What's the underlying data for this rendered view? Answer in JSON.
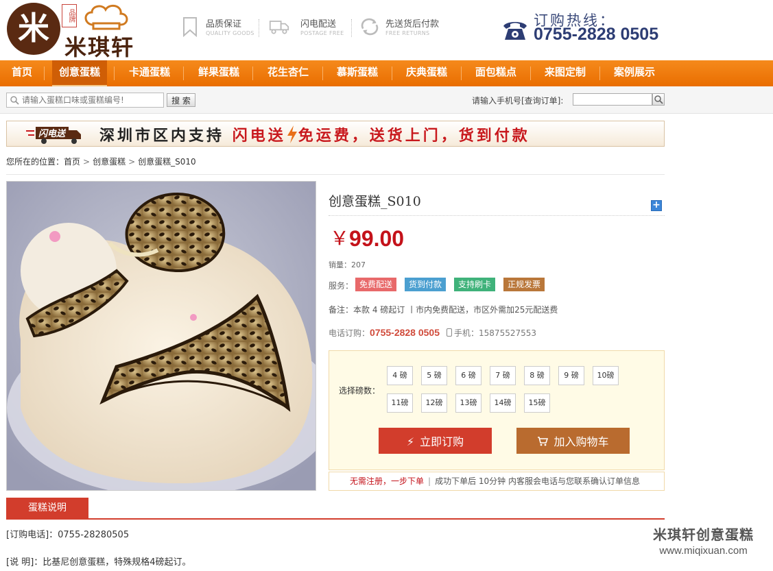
{
  "brand": {
    "logo_char": "米",
    "stamp": "品牌",
    "name": "米琪轩"
  },
  "features": [
    {
      "icon": "bookmark-icon",
      "title": "品质保证",
      "subtitle": "QUALITY GOODS"
    },
    {
      "icon": "truck-icon",
      "title": "闪电配送",
      "subtitle": "POSTAGE FREE"
    },
    {
      "icon": "refresh-icon",
      "title": "先送货后付款",
      "subtitle": "FREE RETURNS"
    }
  ],
  "hotline": {
    "label": "订购热线：",
    "number": "0755-2828 0505"
  },
  "nav": [
    {
      "label": "首页"
    },
    {
      "label": "创意蛋糕",
      "active": true
    },
    {
      "label": "卡通蛋糕"
    },
    {
      "label": "鲜果蛋糕"
    },
    {
      "label": "花生杏仁"
    },
    {
      "label": "慕斯蛋糕"
    },
    {
      "label": "庆典蛋糕"
    },
    {
      "label": "面包糕点"
    },
    {
      "label": "来图定制"
    },
    {
      "label": "案例展示"
    }
  ],
  "search": {
    "placeholder": "请输入蛋糕口味或蛋糕编号!",
    "button": "搜 索",
    "order_query_label": "请输入手机号[查询订单]:"
  },
  "banner": {
    "logo_text": "闪电送",
    "text_a": "深圳市区内支持",
    "text_b": "闪电送",
    "text_c": "免运费，送货上门，货到付款"
  },
  "breadcrumb": {
    "prefix": "您所在的位置：",
    "items": [
      "首页",
      "创意蛋糕",
      "创意蛋糕_S010"
    ],
    "separator": ">"
  },
  "product": {
    "title": "创意蛋糕_S010",
    "currency": "￥",
    "price": "99.00",
    "sales_label": "销量：",
    "sales": "207",
    "services_label": "服务：",
    "services": [
      {
        "label": "免费配送",
        "color": "#e8696a"
      },
      {
        "label": "货到付款",
        "color": "#4b9fd0"
      },
      {
        "label": "支持刷卡",
        "color": "#3fb27a"
      },
      {
        "label": "正规发票",
        "color": "#b9773a"
      }
    ],
    "note": "备注：本款 4 磅起订 丨市内免费配送，市区外需加25元配送费",
    "tel_label": "电话订购：",
    "tel": "0755-2828 0505",
    "mobile_label": "手机：",
    "mobile": "15875527553"
  },
  "weights": {
    "label": "选择磅数：",
    "options": [
      "4 磅",
      "5 磅",
      "6 磅",
      "7 磅",
      "8 磅",
      "9 磅",
      "10磅",
      "11磅",
      "12磅",
      "13磅",
      "14磅",
      "15磅"
    ]
  },
  "actions": {
    "order": "立即订购",
    "cart": "加入购物车"
  },
  "tip": {
    "highlight": "无需注册，一步下单",
    "text": "成功下单后 10分钟 内客服会电话与您联系确认订单信息"
  },
  "description": {
    "tab": "蛋糕说明",
    "line1": "[订购电话]：0755-28280505",
    "line2": "[说 明]：比基尼创意蛋糕，特殊规格4磅起订。"
  },
  "watermark": {
    "line1": "米琪轩创意蛋糕",
    "line2": "www.miqixuan.com"
  }
}
